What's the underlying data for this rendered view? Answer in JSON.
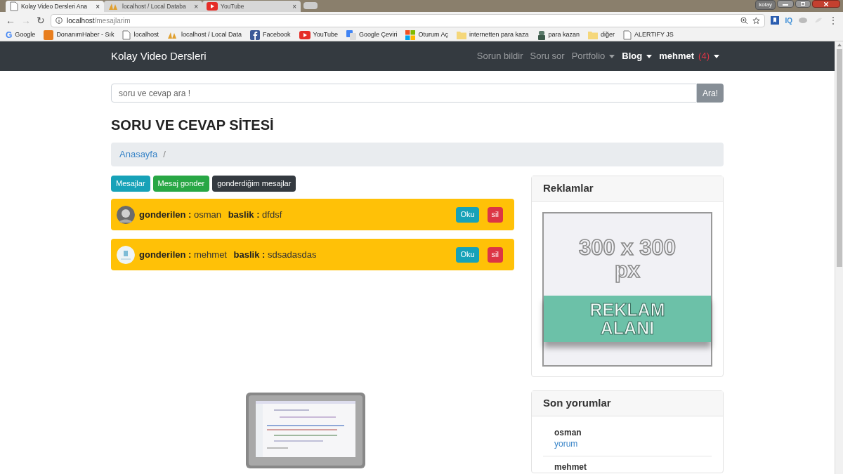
{
  "browser": {
    "tabs": [
      {
        "title": "Kolay Video Dersleri Ana",
        "selected": true,
        "close": "×"
      },
      {
        "title": "localhost / Local Databa",
        "selected": false,
        "close": "×"
      },
      {
        "title": "YouTube",
        "selected": false,
        "close": "×"
      }
    ],
    "nav_buttons": {
      "back": "←",
      "forward": "→",
      "reload": "↻"
    },
    "extension_label": "IQ",
    "menu_glyph": "⋮",
    "user_badge": "kolay",
    "address": {
      "host": "localhost",
      "path": "/mesajlarim"
    },
    "bookmarks": [
      {
        "label": "Google",
        "badge": "G"
      },
      {
        "label": "DonanımHaber - Sık"
      },
      {
        "label": "localhost"
      },
      {
        "label": "localhost / Local Data"
      },
      {
        "label": "Facebook"
      },
      {
        "label": "YouTube"
      },
      {
        "label": "Google Çeviri"
      },
      {
        "label": "Oturum Aç"
      },
      {
        "label": "internetten para kaza"
      },
      {
        "label": "para kazan"
      },
      {
        "label": "diğer"
      },
      {
        "label": "ALERTIFY JS"
      }
    ]
  },
  "navbar": {
    "brand": "Kolay Video Dersleri",
    "items": [
      {
        "label": "Sorun bildir",
        "dropdown": false,
        "highlighted": false
      },
      {
        "label": "Soru sor",
        "dropdown": false,
        "highlighted": false
      },
      {
        "label": "Portfolio",
        "dropdown": true,
        "highlighted": false
      },
      {
        "label": "Blog",
        "dropdown": true,
        "highlighted": true
      }
    ],
    "user": {
      "name": "mehmet",
      "count": "(4)"
    }
  },
  "search": {
    "placeholder": "soru ve cevap ara !",
    "button": "Ara!"
  },
  "heading": "SORU VE CEVAP SİTESİ",
  "breadcrumb": {
    "items": [
      "Anasayfa"
    ],
    "separator": "/"
  },
  "tabs": [
    {
      "label": "Mesajlar",
      "color": "#17a2b8"
    },
    {
      "label": "Mesaj gonder",
      "color": "#28a745"
    },
    {
      "label": "gonderdiğim mesajlar",
      "color": "#343a40"
    }
  ],
  "messages": [
    {
      "sender_label": "gonderilen :",
      "sender": "osman",
      "title_label": "baslik :",
      "title": "dfdsf",
      "read": "Oku",
      "delete": "sil"
    },
    {
      "sender_label": "gonderilen :",
      "sender": "mehmet",
      "title_label": "baslik :",
      "title": "sdsadasdas",
      "read": "Oku",
      "delete": "sil"
    }
  ],
  "ads": {
    "title": "Reklamlar",
    "size_text": "300 x 300 px",
    "banner_text": "REKLAM ALANI"
  },
  "comments": {
    "title": "Son yorumlar",
    "items": [
      {
        "user": "osman",
        "link": "yorum"
      },
      {
        "user": "mehmet"
      }
    ]
  }
}
